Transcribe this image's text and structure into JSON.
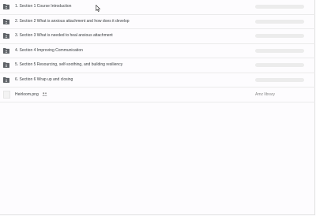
{
  "folders": [
    {
      "label": "1. Section 1 Course Introduction",
      "icon": "shared-folder-icon"
    },
    {
      "label": "2. Section 2 What is anxious attachment and how does it develop",
      "icon": "shared-folder-icon"
    },
    {
      "label": "3. Section 3 What is needed to heal anxious attachment",
      "icon": "shared-folder-icon"
    },
    {
      "label": "4. Section 4 Improving Communication",
      "icon": "shared-folder-icon"
    },
    {
      "label": "5. Section 5 Resourcing, self-soothing, and building resiliency",
      "icon": "shared-folder-icon"
    },
    {
      "label": "6. Section 6 Wrap up and closing",
      "icon": "shared-folder-icon"
    }
  ],
  "file": {
    "name": "Heirloom.png",
    "shared_icon": "people-icon",
    "owner": "Amz library"
  },
  "colors": {
    "folder": "#5f6368",
    "skeleton": "#ececec",
    "divider": "#ebebeb"
  }
}
